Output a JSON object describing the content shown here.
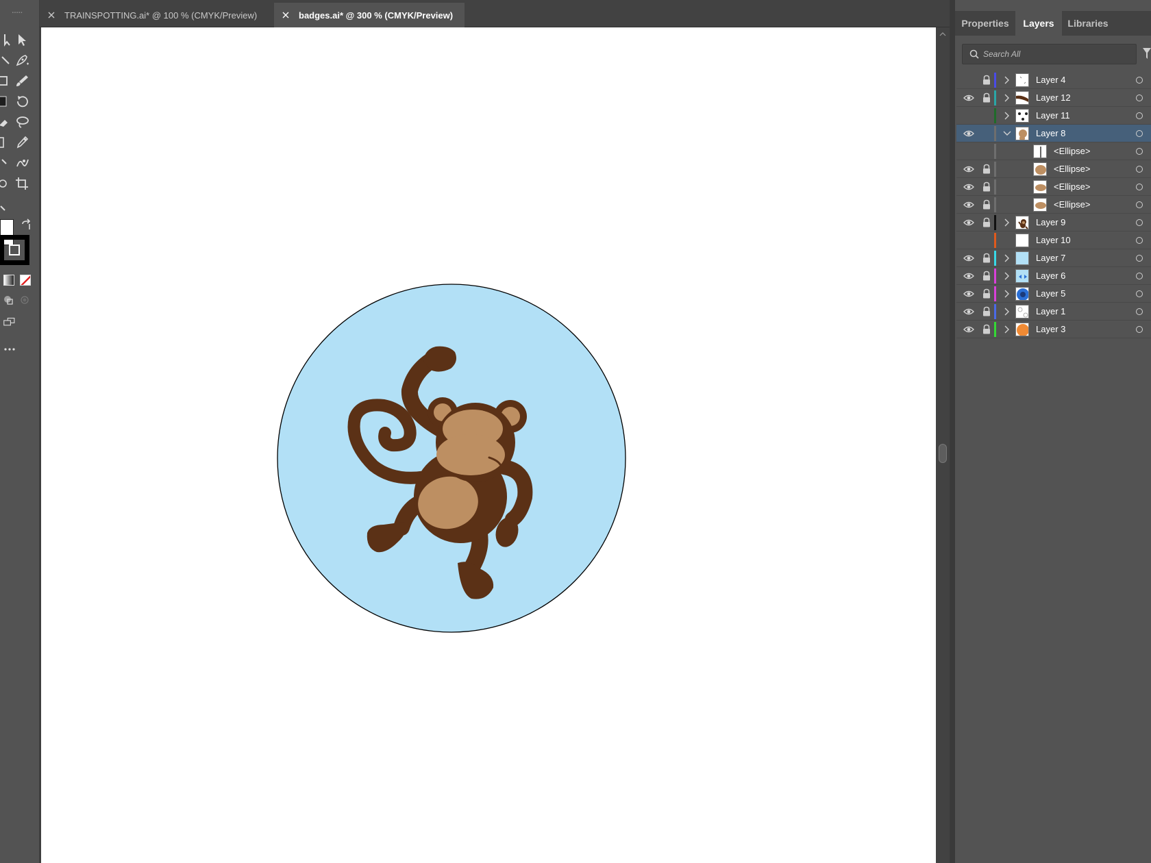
{
  "tabs": [
    {
      "label": "TRAINSPOTTING.ai* @ 100 % (CMYK/Preview)",
      "active": false
    },
    {
      "label": "badges.ai* @ 300 % (CMYK/Preview)",
      "active": true
    }
  ],
  "panel": {
    "tabs": [
      "Properties",
      "Layers",
      "Libraries"
    ],
    "active_tab": "Layers",
    "search": {
      "placeholder": "Search All",
      "value": ""
    }
  },
  "layers": [
    {
      "name": "Layer 4",
      "visible": false,
      "locked": true,
      "color": "#4a4ae8",
      "expand": "collapsed",
      "thumb": "sparse"
    },
    {
      "name": "Layer 12",
      "visible": true,
      "locked": true,
      "color": "#2aa6a6",
      "expand": "collapsed",
      "thumb": "branch"
    },
    {
      "name": "Layer 11",
      "visible": false,
      "locked": false,
      "color": "#1f6b2a",
      "expand": "collapsed",
      "thumb": "dots"
    },
    {
      "name": "Layer 8",
      "visible": true,
      "locked": false,
      "color": "#6e6e6e",
      "expand": "expanded",
      "selected": true,
      "thumb": "monkey-face"
    },
    {
      "name": "<Ellipse>",
      "visible": false,
      "locked": false,
      "color": "#6e6e6e",
      "sublayer": true,
      "thumb": "line"
    },
    {
      "name": "<Ellipse>",
      "visible": true,
      "locked": true,
      "color": "#6e6e6e",
      "sublayer": true,
      "thumb": "ellipse"
    },
    {
      "name": "<Ellipse>",
      "visible": true,
      "locked": true,
      "color": "#6e6e6e",
      "sublayer": true,
      "thumb": "ellipse-wide"
    },
    {
      "name": "<Ellipse>",
      "visible": true,
      "locked": true,
      "color": "#6e6e6e",
      "sublayer": true,
      "thumb": "ellipse-wide"
    },
    {
      "name": "Layer 9",
      "visible": true,
      "locked": true,
      "color": "#111111",
      "expand": "collapsed",
      "thumb": "monkey"
    },
    {
      "name": "Layer 10",
      "visible": false,
      "locked": false,
      "color": "#e05a1c",
      "expand": "none",
      "thumb": "blank"
    },
    {
      "name": "Layer 7",
      "visible": true,
      "locked": true,
      "color": "#38d9e8",
      "expand": "collapsed",
      "thumb": "lightblue"
    },
    {
      "name": "Layer 6",
      "visible": true,
      "locked": true,
      "color": "#d940d9",
      "expand": "collapsed",
      "thumb": "blue-arrows"
    },
    {
      "name": "Layer 5",
      "visible": true,
      "locked": true,
      "color": "#d940d9",
      "expand": "collapsed",
      "thumb": "blue-circle"
    },
    {
      "name": "Layer 1",
      "visible": true,
      "locked": true,
      "color": "#4a6ae8",
      "expand": "collapsed",
      "thumb": "circles"
    },
    {
      "name": "Layer 3",
      "visible": true,
      "locked": true,
      "color": "#34d934",
      "expand": "collapsed",
      "thumb": "orange-circle"
    }
  ],
  "colors": {
    "badge_fill": "#b2e0f6",
    "monkey_brown": "#5b3116",
    "monkey_tan": "#bd8f62",
    "selection": "#46607a"
  },
  "tools": [
    "selection-tool",
    "direct-selection-tool",
    "pen-tool",
    "curvature-tool",
    "rectangle-tool",
    "paintbrush-tool",
    "shaper-tool",
    "rotate-tool",
    "eraser-tool",
    "lasso-tool",
    "width-tool",
    "eyedropper-tool",
    "gradient-tool",
    "puppet-warp-tool",
    "ellipse-tool",
    "crop-tool"
  ]
}
